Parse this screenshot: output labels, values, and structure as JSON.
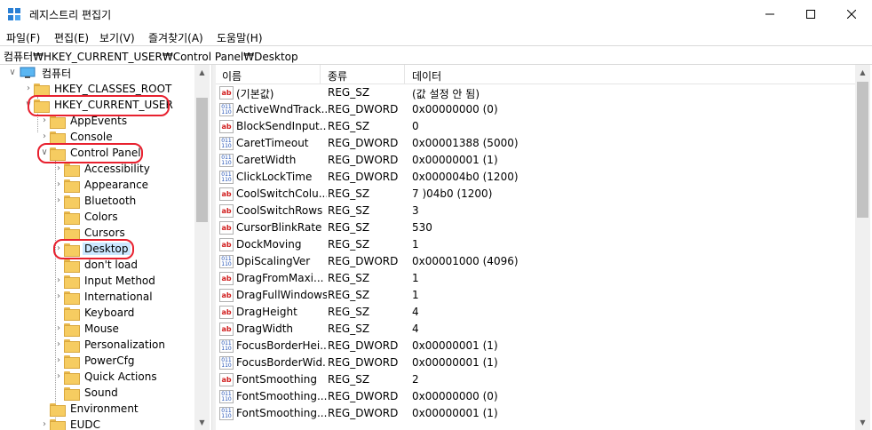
{
  "window": {
    "title": "레지스트리 편집기",
    "minimize_icon": "minimize-icon",
    "maximize_icon": "maximize-icon",
    "close_icon": "close-icon"
  },
  "menu": [
    "파일(F)",
    "편집(E)",
    "보기(V)",
    "즐겨찾기(A)",
    "도움말(H)"
  ],
  "address": "컴퓨터₩HKEY_CURRENT_USER₩Control Panel₩Desktop",
  "tree": {
    "root": "컴퓨터",
    "nodes": [
      {
        "label": "HKEY_CLASSES_ROOT"
      },
      {
        "label": "HKEY_CURRENT_USER"
      },
      {
        "label": "AppEvents"
      },
      {
        "label": "Console"
      },
      {
        "label": "Control Panel"
      },
      {
        "label": "Accessibility"
      },
      {
        "label": "Appearance"
      },
      {
        "label": "Bluetooth"
      },
      {
        "label": "Colors"
      },
      {
        "label": "Cursors"
      },
      {
        "label": "Desktop"
      },
      {
        "label": "don't load"
      },
      {
        "label": "Input Method"
      },
      {
        "label": "International"
      },
      {
        "label": "Keyboard"
      },
      {
        "label": "Mouse"
      },
      {
        "label": "Personalization"
      },
      {
        "label": "PowerCfg"
      },
      {
        "label": "Quick Actions"
      },
      {
        "label": "Sound"
      },
      {
        "label": "Environment"
      },
      {
        "label": "EUDC"
      }
    ]
  },
  "columns": {
    "name": "이름",
    "type": "종류",
    "data": "데이터"
  },
  "values": [
    {
      "icon": "ab",
      "name": "(기본값)",
      "type": "REG_SZ",
      "data": "(값 설정 안 됨)"
    },
    {
      "icon": "bin",
      "name": "ActiveWndTrack...",
      "type": "REG_DWORD",
      "data": "0x00000000 (0)"
    },
    {
      "icon": "ab",
      "name": "BlockSendInput...",
      "type": "REG_SZ",
      "data": "0"
    },
    {
      "icon": "bin",
      "name": "CaretTimeout",
      "type": "REG_DWORD",
      "data": "0x00001388 (5000)"
    },
    {
      "icon": "bin",
      "name": "CaretWidth",
      "type": "REG_DWORD",
      "data": "0x00000001 (1)"
    },
    {
      "icon": "bin",
      "name": "ClickLockTime",
      "type": "REG_DWORD",
      "data": "0x000004b0 (1200)"
    },
    {
      "icon": "ab",
      "name": "CoolSwitchColu...",
      "type": "REG_SZ",
      "data": "7        )04b0 (1200)"
    },
    {
      "icon": "ab",
      "name": "CoolSwitchRows",
      "type": "REG_SZ",
      "data": "3"
    },
    {
      "icon": "ab",
      "name": "CursorBlinkRate",
      "type": "REG_SZ",
      "data": "530"
    },
    {
      "icon": "ab",
      "name": "DockMoving",
      "type": "REG_SZ",
      "data": "1"
    },
    {
      "icon": "bin",
      "name": "DpiScalingVer",
      "type": "REG_DWORD",
      "data": "0x00001000 (4096)"
    },
    {
      "icon": "ab",
      "name": "DragFromMaxi...",
      "type": "REG_SZ",
      "data": "1"
    },
    {
      "icon": "ab",
      "name": "DragFullWindows",
      "type": "REG_SZ",
      "data": "1"
    },
    {
      "icon": "ab",
      "name": "DragHeight",
      "type": "REG_SZ",
      "data": "4"
    },
    {
      "icon": "ab",
      "name": "DragWidth",
      "type": "REG_SZ",
      "data": "4"
    },
    {
      "icon": "bin",
      "name": "FocusBorderHei...",
      "type": "REG_DWORD",
      "data": "0x00000001 (1)"
    },
    {
      "icon": "bin",
      "name": "FocusBorderWid...",
      "type": "REG_DWORD",
      "data": "0x00000001 (1)"
    },
    {
      "icon": "ab",
      "name": "FontSmoothing",
      "type": "REG_SZ",
      "data": "2"
    },
    {
      "icon": "bin",
      "name": "FontSmoothing...",
      "type": "REG_DWORD",
      "data": "0x00000000 (0)"
    },
    {
      "icon": "bin",
      "name": "FontSmoothing...",
      "type": "REG_DWORD",
      "data": "0x00000001 (1)"
    }
  ],
  "icons": {
    "ab_text": "ab",
    "bin_text": "011\n110"
  },
  "highlight_color": "#e8212f",
  "selection_color": "#cce8ff"
}
